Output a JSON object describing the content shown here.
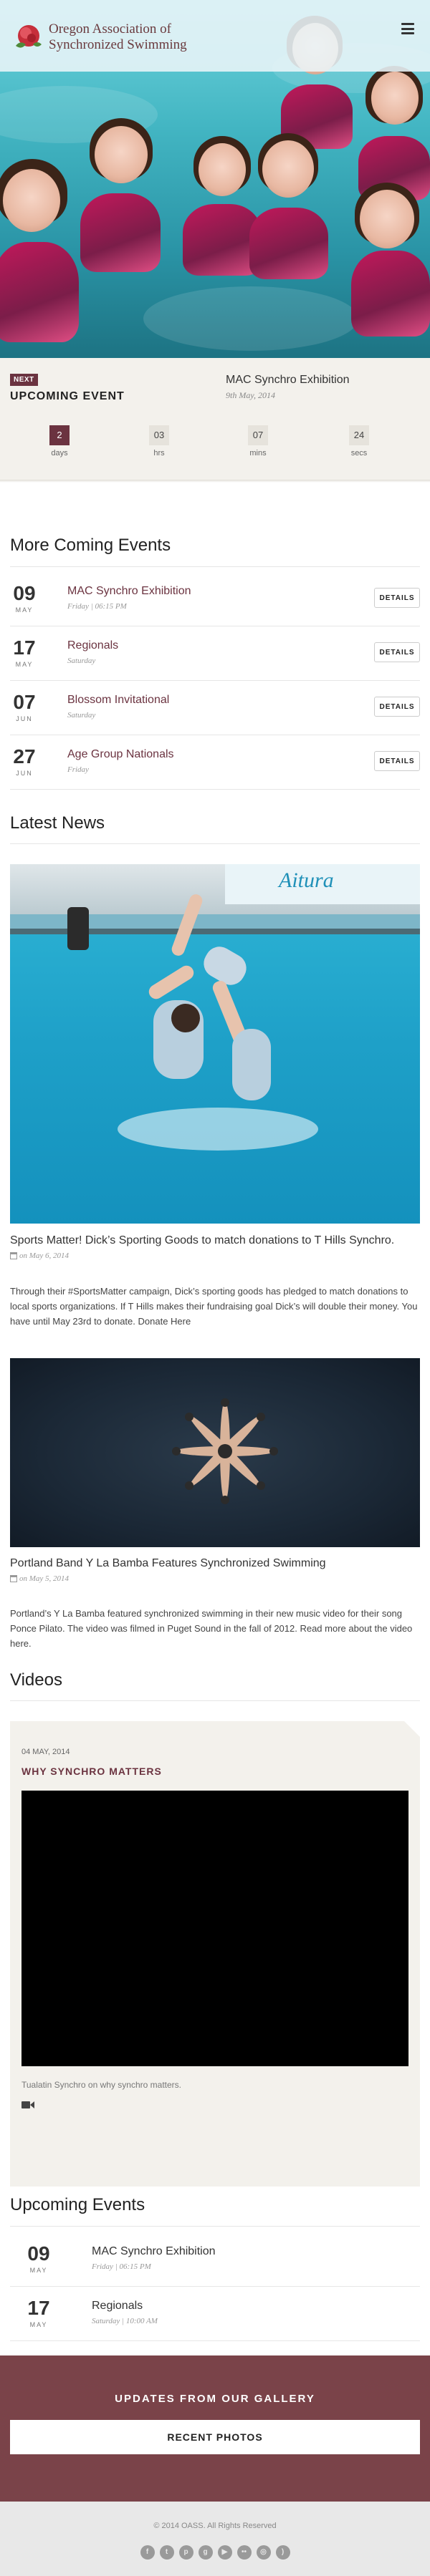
{
  "header": {
    "logo_line1": "Oregon Association of",
    "logo_line2": "Synchronized Swimming"
  },
  "next_event": {
    "tag": "NEXT",
    "label": "UPCOMING EVENT",
    "title": "MAC Synchro Exhibition",
    "date": "9th May, 2014",
    "countdown": [
      {
        "value": "2",
        "unit": "days"
      },
      {
        "value": "03",
        "unit": "hrs"
      },
      {
        "value": "07",
        "unit": "mins"
      },
      {
        "value": "24",
        "unit": "secs"
      }
    ]
  },
  "coming_events": {
    "heading": "More Coming Events",
    "details_label": "DETAILS",
    "items": [
      {
        "day": "09",
        "month": "MAY",
        "name": "MAC Synchro Exhibition",
        "when": "Friday | 06:15 PM"
      },
      {
        "day": "17",
        "month": "MAY",
        "name": "Regionals",
        "when": "Saturday"
      },
      {
        "day": "07",
        "month": "JUN",
        "name": "Blossom Invitational",
        "when": "Saturday"
      },
      {
        "day": "27",
        "month": "JUN",
        "name": "Age Group Nationals",
        "when": "Friday"
      }
    ]
  },
  "news": {
    "heading": "Latest News",
    "items": [
      {
        "title": "Sports Matter! Dick’s Sporting Goods to match donations to T Hills Synchro.",
        "date": "on May 6, 2014",
        "body": "Through their #SportsMatter campaign, Dick’s sporting goods has pledged to match donations to local sports organizations.  If T Hills makes their fundraising goal Dick’s will double their money. You have until May 23rd to donate. Donate Here",
        "image_sign": "Aitura"
      },
      {
        "title": "Portland Band Y La Bamba Features Synchronized Swimming",
        "date": "on May 5, 2014",
        "body": "Portland’s Y La Bamba featured synchronized swimming in their new music video for their song Ponce Pilato.  The video was filmed in Puget Sound in the fall of 2012.  Read more about the video here."
      }
    ]
  },
  "videos": {
    "heading": "Videos",
    "date": "04 MAY, 2014",
    "title": "WHY SYNCHRO MATTERS",
    "caption": "Tualatin Synchro on why synchro matters."
  },
  "upcoming_events": {
    "heading": "Upcoming Events",
    "items": [
      {
        "day": "09",
        "month": "MAY",
        "name": "MAC Synchro Exhibition",
        "when": "Friday | 06:15 PM"
      },
      {
        "day": "17",
        "month": "MAY",
        "name": "Regionals",
        "when": "Saturday | 10:00 AM"
      }
    ]
  },
  "gallery": {
    "title": "UPDATES FROM OUR GALLERY",
    "button": "RECENT PHOTOS"
  },
  "footer": {
    "copyright": "© 2014 OASS. All Rights Reserved",
    "socials": [
      {
        "icon": "facebook-icon",
        "glyph": "f"
      },
      {
        "icon": "twitter-icon",
        "glyph": "t"
      },
      {
        "icon": "pinterest-icon",
        "glyph": "p"
      },
      {
        "icon": "google-plus-icon",
        "glyph": "g"
      },
      {
        "icon": "youtube-icon",
        "glyph": "▶"
      },
      {
        "icon": "flickr-icon",
        "glyph": "••"
      },
      {
        "icon": "instagram-icon",
        "glyph": "◎"
      },
      {
        "icon": "rss-icon",
        "glyph": ")"
      }
    ]
  },
  "colors": {
    "brand": "#6b3340",
    "gallery_bg": "#7a4349",
    "panel_bg": "#f3f1ec"
  }
}
